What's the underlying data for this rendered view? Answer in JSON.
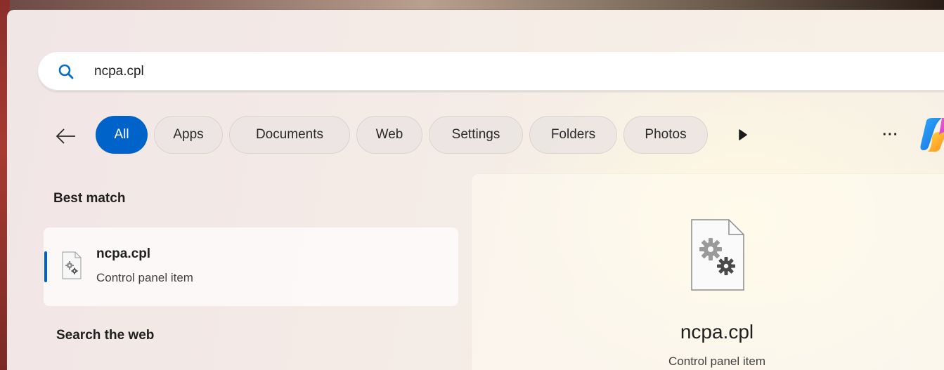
{
  "search": {
    "value": "ncpa.cpl",
    "icon": "search-icon"
  },
  "filters": {
    "back_icon": "arrow-left-icon",
    "tabs": [
      {
        "label": "All",
        "active": true
      },
      {
        "label": "Apps",
        "active": false
      },
      {
        "label": "Documents",
        "active": false
      },
      {
        "label": "Web",
        "active": false
      },
      {
        "label": "Settings",
        "active": false
      },
      {
        "label": "Folders",
        "active": false
      },
      {
        "label": "Photos",
        "active": false
      }
    ],
    "more_tabs_icon": "play-icon",
    "overflow_label": "···",
    "copilot_icon": "copilot-icon"
  },
  "results": {
    "best_match_heading": "Best match",
    "best_match": {
      "title": "ncpa.cpl",
      "subtitle": "Control panel item",
      "icon": "control-panel-file-icon"
    },
    "search_web_heading": "Search the web"
  },
  "preview": {
    "title": "ncpa.cpl",
    "subtitle": "Control panel item",
    "icon": "control-panel-file-icon"
  },
  "colors": {
    "accent": "#0063c9",
    "search_icon": "#0a6cc2"
  }
}
